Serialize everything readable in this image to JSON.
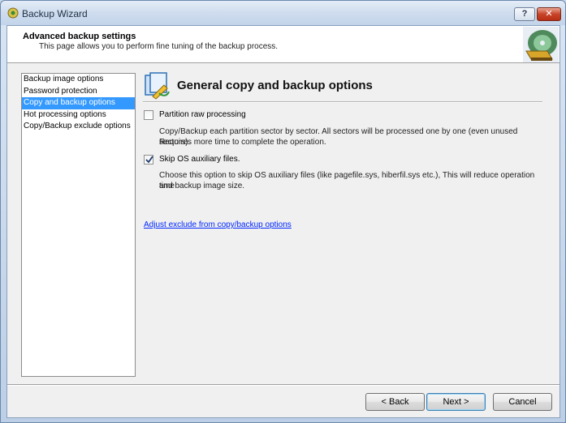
{
  "window": {
    "title": "Backup Wizard",
    "help_label": "?",
    "close_label": "✕"
  },
  "header": {
    "title": "Advanced backup settings",
    "subtitle": "This page allows you to perform fine tuning of the backup process."
  },
  "sidebar": {
    "items": [
      {
        "label": "Backup image options",
        "selected": false
      },
      {
        "label": "Password protection",
        "selected": false
      },
      {
        "label": "Copy and backup options",
        "selected": true
      },
      {
        "label": "Hot processing options",
        "selected": false
      },
      {
        "label": "Copy/Backup exclude options",
        "selected": false
      }
    ]
  },
  "section": {
    "title": "General copy and backup options",
    "options": [
      {
        "label": "Partition raw processing",
        "checked": false,
        "desc_line1": "Copy/Backup each partition sector by sector. All sectors will be processed one by one (even unused sectors).",
        "desc_line2": "Requires more time to complete the operation."
      },
      {
        "label": "Skip OS auxiliary files.",
        "checked": true,
        "desc_line1": "Choose this option to skip OS auxiliary files (like pagefile.sys, hiberfil.sys etc.), This will reduce operation time",
        "desc_line2": "and backup image size."
      }
    ],
    "link": "Adjust exclude from copy/backup options"
  },
  "buttons": {
    "back": "< Back",
    "next": "Next >",
    "cancel": "Cancel"
  },
  "icons": {
    "app": "backup-wizard-icon",
    "header": "disk-backup-logo-icon",
    "section": "copy-options-icon",
    "check": "checkmark-icon"
  }
}
